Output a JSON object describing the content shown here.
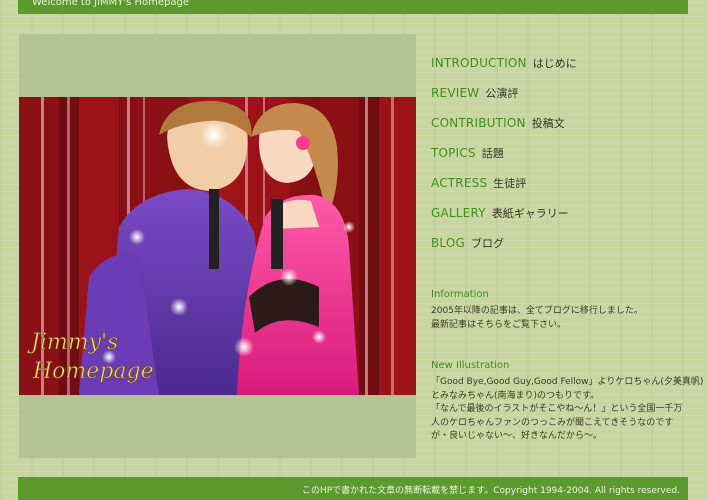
{
  "header": {
    "welcome": "Welcome to JIMMY's Homepage"
  },
  "hero": {
    "logo_line1": "Jimmy's",
    "logo_line2": "Homepage"
  },
  "nav": [
    {
      "en": "INTRODUCTION",
      "jp": "はじめに"
    },
    {
      "en": "REVIEW",
      "jp": "公演評"
    },
    {
      "en": "CONTRIBUTION",
      "jp": "投稿文"
    },
    {
      "en": "TOPICS",
      "jp": "話題"
    },
    {
      "en": "ACTRESS",
      "jp": "生徒評"
    },
    {
      "en": "GALLERY",
      "jp": "表紙ギャラリー"
    },
    {
      "en": "BLOG",
      "jp": "ブログ"
    }
  ],
  "information": {
    "heading": "Information",
    "lines": [
      "2005年以降の記事は、全てブログに移行しました。",
      "最新記事はそちらをご覧下さい。"
    ]
  },
  "new_illustration": {
    "heading": "New Illustration",
    "lines": [
      "「Good Bye,Good Guy,Good Fellow」よりケロちゃん(夕美真帆)",
      "とみなみちゃん(南海まり)のつもりです。",
      "「なんで最後のイラストがそこやね～ん！」という全国一千万",
      "人のケロちゃんファンのつっこみが聞こえてきそうなのです",
      "が・良いじゃない～、好きなんだから～。"
    ]
  },
  "footer": {
    "copyright": "このHPで書かれた文章の無断転載を禁じます。Copyright 1994-2004. All rights reserved."
  },
  "colors": {
    "accent_green": "#5b9a2e",
    "link_green": "#3f8f1a",
    "background": "#c9d6a2"
  }
}
